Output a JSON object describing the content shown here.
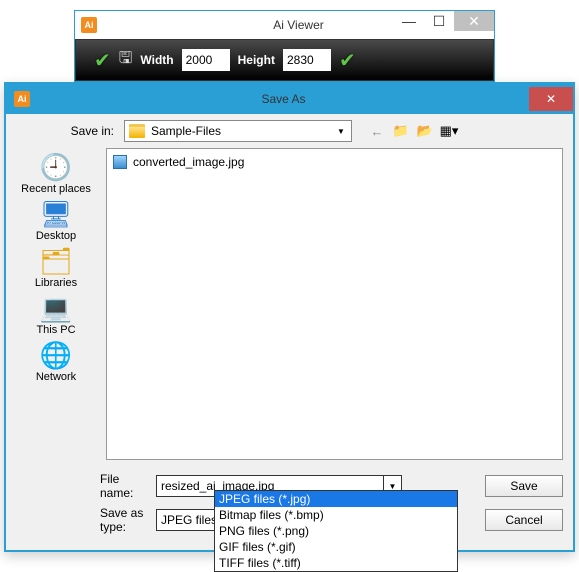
{
  "viewer": {
    "title": "Ai Viewer",
    "width_label": "Width",
    "width_value": "2000",
    "height_label": "Height",
    "height_value": "2830"
  },
  "saveas": {
    "title": "Save As",
    "save_in_label": "Save in:",
    "save_in_value": "Sample-Files",
    "file_listed": "converted_image.jpg",
    "places": {
      "recent": "Recent places",
      "desktop": "Desktop",
      "libraries": "Libraries",
      "thispc": "This PC",
      "network": "Network"
    },
    "filename_label": "File name:",
    "filename_value": "resized_ai_image.jpg",
    "savetype_label": "Save as type:",
    "savetype_value": "JPEG files (*.jpg)",
    "save_btn": "Save",
    "cancel_btn": "Cancel",
    "type_options": [
      "JPEG files (*.jpg)",
      "Bitmap files (*.bmp)",
      "PNG files (*.png)",
      "GIF files (*.gif)",
      "TIFF files (*.tiff)"
    ]
  }
}
